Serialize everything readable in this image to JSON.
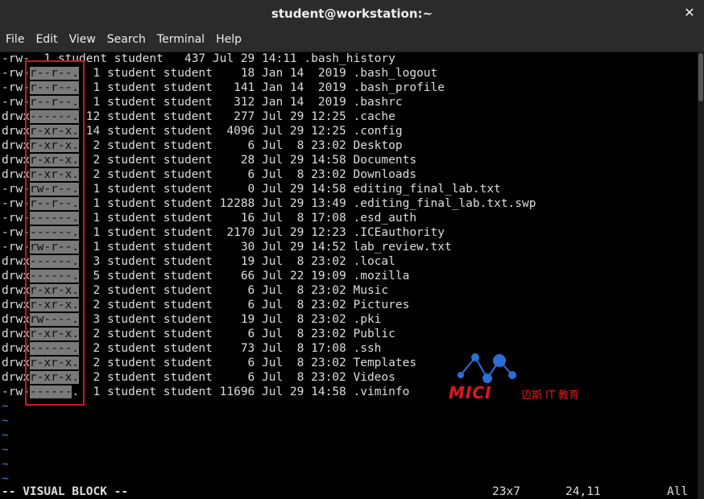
{
  "window": {
    "title": "student@workstation:~"
  },
  "menu": [
    "File",
    "Edit",
    "View",
    "Search",
    "Terminal",
    "Help"
  ],
  "lines": [
    {
      "pre": "-rw-",
      "sel": "",
      "post": "  1 student student   437 Jul 29 14:11 .bash_history"
    },
    {
      "pre": "-rw-",
      "sel": "r--r--.",
      "post": "  1 student student    18 Jan 14  2019 .bash_logout"
    },
    {
      "pre": "-rw-",
      "sel": "r--r--.",
      "post": "  1 student student   141 Jan 14  2019 .bash_profile"
    },
    {
      "pre": "-rw-",
      "sel": "r--r--.",
      "post": "  1 student student   312 Jan 14  2019 .bashrc"
    },
    {
      "pre": "drwx",
      "sel": "------.",
      "post": " 12 student student   277 Jul 29 12:25 .cache"
    },
    {
      "pre": "drwx",
      "sel": "r-xr-x.",
      "post": " 14 student student  4096 Jul 29 12:25 .config"
    },
    {
      "pre": "drwx",
      "sel": "r-xr-x.",
      "post": "  2 student student     6 Jul  8 23:02 Desktop"
    },
    {
      "pre": "drwx",
      "sel": "r-xr-x.",
      "post": "  2 student student    28 Jul 29 14:58 Documents"
    },
    {
      "pre": "drwx",
      "sel": "r-xr-x.",
      "post": "  2 student student     6 Jul  8 23:02 Downloads"
    },
    {
      "pre": "-rw-",
      "sel": "rw-r--.",
      "post": "  1 student student     0 Jul 29 14:58 editing_final_lab.txt"
    },
    {
      "pre": "-rw-",
      "sel": "r--r--.",
      "post": "  1 student student 12288 Jul 29 13:49 .editing_final_lab.txt.swp"
    },
    {
      "pre": "-rw-",
      "sel": "------.",
      "post": "  1 student student    16 Jul  8 17:08 .esd_auth"
    },
    {
      "pre": "-rw-",
      "sel": "------.",
      "post": "  1 student student  2170 Jul 29 12:23 .ICEauthority"
    },
    {
      "pre": "-rw-",
      "sel": "rw-r--.",
      "post": "  1 student student    30 Jul 29 14:52 lab_review.txt"
    },
    {
      "pre": "drwx",
      "sel": "------.",
      "post": "  3 student student    19 Jul  8 23:02 .local"
    },
    {
      "pre": "drwx",
      "sel": "------.",
      "post": "  5 student student    66 Jul 22 19:09 .mozilla"
    },
    {
      "pre": "drwx",
      "sel": "r-xr-x.",
      "post": "  2 student student     6 Jul  8 23:02 Music"
    },
    {
      "pre": "drwx",
      "sel": "r-xr-x.",
      "post": "  2 student student     6 Jul  8 23:02 Pictures"
    },
    {
      "pre": "drwx",
      "sel": "rw----.",
      "post": "  3 student student    19 Jul  8 23:02 .pki"
    },
    {
      "pre": "drwx",
      "sel": "r-xr-x.",
      "post": "  2 student student     6 Jul  8 23:02 Public"
    },
    {
      "pre": "drwx",
      "sel": "------.",
      "post": "  2 student student    73 Jul  8 17:08 .ssh"
    },
    {
      "pre": "drwx",
      "sel": "r-xr-x.",
      "post": "  2 student student     6 Jul  8 23:02 Templates"
    },
    {
      "pre": "drwx",
      "sel": "r-xr-x.",
      "post": "  2 student student     6 Jul  8 23:02 Videos"
    },
    {
      "pre": "-rw-",
      "sel": "------",
      "post": ".  1 student student 11696 Jul 29 14:58 .viminfo"
    }
  ],
  "tildes": [
    "~",
    "~",
    "~",
    "~",
    "~",
    "~"
  ],
  "status": {
    "mode": "-- VISUAL BLOCK --",
    "selection_size": "23x7",
    "cursor": "24,11",
    "scroll": "All"
  },
  "watermark": {
    "brand": "MICI",
    "subtitle": "迈斯 IT 教育"
  },
  "colors": {
    "highlight_box": "#d0161f",
    "selection": "#7a7a7a",
    "tilde": "#3a7fc4",
    "brand": "#e8131b"
  },
  "icons": {
    "close": "close-icon"
  }
}
